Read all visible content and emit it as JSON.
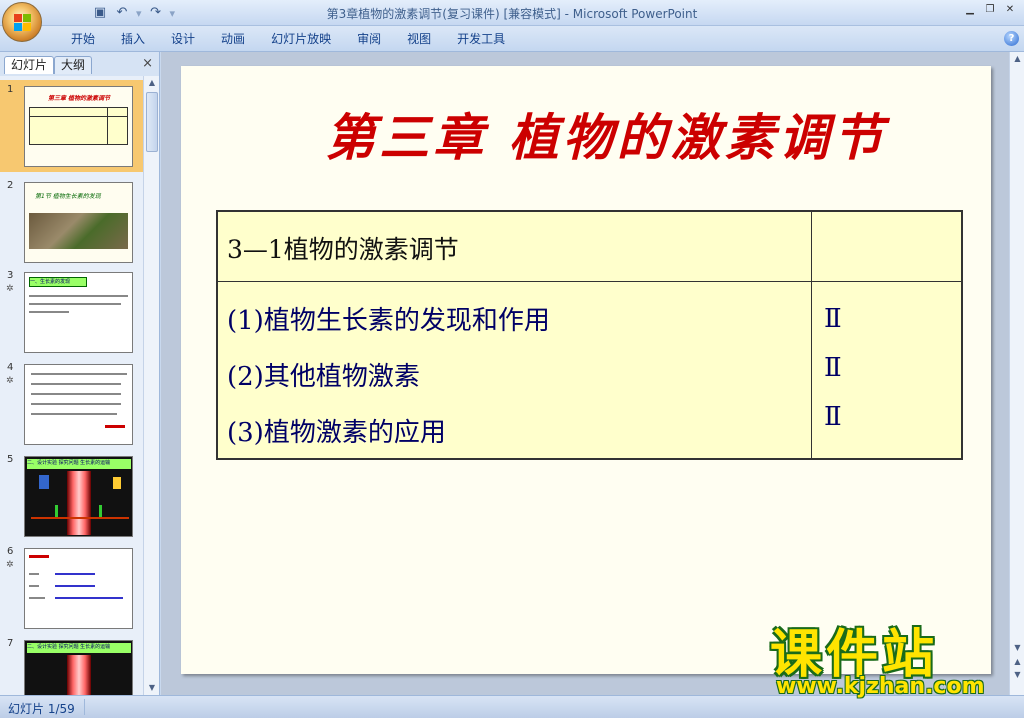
{
  "window": {
    "title": "第3章植物的激素调节(复习课件) [兼容模式] - Microsoft PowerPoint"
  },
  "qat": {
    "save_icon": "save-icon",
    "undo_icon": "undo-icon",
    "redo_icon": "redo-icon",
    "customize_icon": "dropdown-icon"
  },
  "ribbon": {
    "tabs": [
      "开始",
      "插入",
      "设计",
      "动画",
      "幻灯片放映",
      "审阅",
      "视图",
      "开发工具"
    ],
    "help": "?"
  },
  "pane": {
    "tab_slides": "幻灯片",
    "tab_outline": "大纲",
    "close": "×",
    "thumbnails": [
      {
        "num": "1",
        "title": "第三章 植物的激素调节"
      },
      {
        "num": "2",
        "title": "第1节 植物生长素的发现"
      },
      {
        "num": "3",
        "title": "一、生长素的发现"
      },
      {
        "num": "4",
        "title": ""
      },
      {
        "num": "5",
        "title": "二、设计实验 探究问题 生长素的运输"
      },
      {
        "num": "6",
        "title": ""
      },
      {
        "num": "7",
        "title": "二、设计实验 探究问题 生长素的运输"
      }
    ]
  },
  "slide": {
    "title": "第三章 植物的激素调节",
    "table": {
      "header": "3—1植物的激素调节",
      "header_level": "",
      "items": [
        {
          "text": "(1)植物生长素的发现和作用",
          "level": "Ⅱ"
        },
        {
          "text": "(2)其他植物激素",
          "level": "Ⅱ"
        },
        {
          "text": "(3)植物激素的应用",
          "level": "Ⅱ"
        }
      ]
    }
  },
  "status": {
    "slide_counter": "幻灯片 1/59"
  },
  "watermark": {
    "brand": "课件站",
    "url": "www.kjzhan.com"
  },
  "colors": {
    "title_red": "#cc0000",
    "table_fill": "#ffffcc",
    "item_blue": "#000066",
    "selection": "#f7c870"
  }
}
